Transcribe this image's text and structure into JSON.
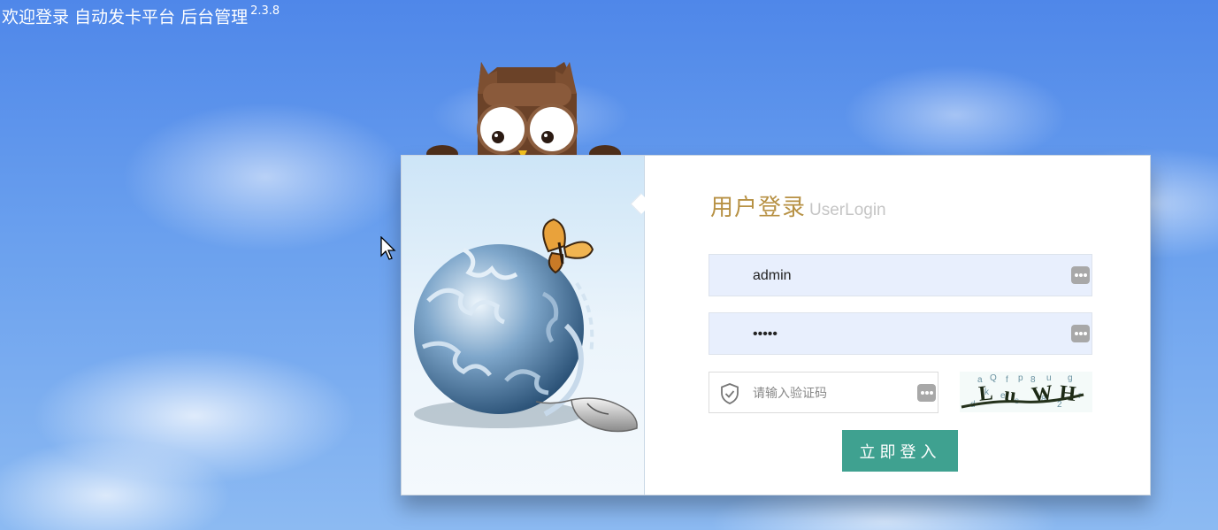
{
  "page": {
    "title": "欢迎登录 自动发卡平台 后台管理",
    "version": "2.3.8"
  },
  "login": {
    "heading_cn": "用户登录",
    "heading_en": "UserLogin",
    "username": {
      "value": "admin"
    },
    "password": {
      "value": "•••••"
    },
    "captcha": {
      "placeholder": "请输入验证码"
    },
    "submit_label": "立即登入"
  },
  "icons": {
    "keyboard": "keyboard-icon",
    "shield": "shield-check-icon",
    "mascot": "owl-mascot",
    "illustration": "puzzle-globe-illustration"
  },
  "colors": {
    "accent": "#3fa190",
    "heading": "#b79144",
    "input_bg": "#e8effd"
  }
}
